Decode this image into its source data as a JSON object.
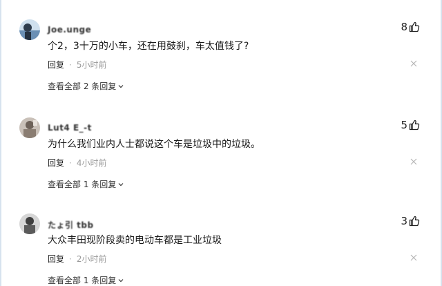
{
  "comments": [
    {
      "username": "Joe.unge",
      "text": "𠆤2，3十万的小车，还在用鼓刹，车太值钱了?",
      "likes": "8",
      "reply_label": "回复",
      "separator": "·",
      "time": "5小时前",
      "view_replies": "查看全部 2 条回复",
      "avatar_color": "#6a8fb4"
    },
    {
      "username": "Lut4 E_-t",
      "text": "为什么我们业内人士都说这个车是垃圾中的垃圾。",
      "likes": "5",
      "reply_label": "回复",
      "separator": "·",
      "time": "4小时前",
      "view_replies": "查看全部 1 条回复",
      "avatar_color": "#8a7d72"
    },
    {
      "username": "たょ引 tbb",
      "text": "大众丰田现阶段卖的电动车都是工业垃圾",
      "likes": "3",
      "reply_label": "回复",
      "separator": "·",
      "time": "2小时前",
      "view_replies": "查看全部 1 条回复",
      "avatar_color": "#5a5a5a"
    }
  ],
  "icons": {
    "like": "thumbs-up-icon",
    "close": "close-icon",
    "expand": "chevron-down-icon"
  }
}
